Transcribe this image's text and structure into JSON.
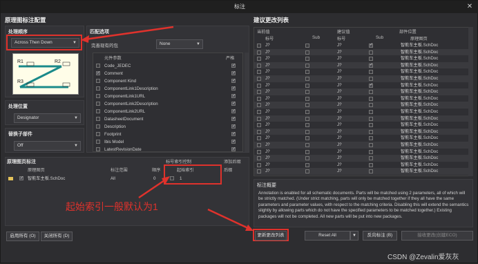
{
  "window": {
    "title": "标注",
    "close": "✕"
  },
  "left_title": "原理图标注配置",
  "order_panel": {
    "title": "处理顺序",
    "selected": "Across Then Down"
  },
  "location_panel": {
    "title": "处理位置",
    "selected": "Designator"
  },
  "replace_panel": {
    "title": "替换子部件",
    "selected": "Off"
  },
  "match_panel": {
    "title": "匹配选项",
    "pkg_label": "完善现有的包",
    "pkg_value": "None",
    "col_param": "元件参数",
    "col_strict": "严格",
    "params": [
      {
        "name": "Code_JEDEC",
        "checked": false,
        "strict": true
      },
      {
        "name": "Comment",
        "checked": true,
        "strict": true
      },
      {
        "name": "Component Kind",
        "checked": false,
        "strict": true
      },
      {
        "name": "ComponentLink1Description",
        "checked": false,
        "strict": true
      },
      {
        "name": "ComponentLink1URL",
        "checked": false,
        "strict": true
      },
      {
        "name": "ComponentLink2Description",
        "checked": false,
        "strict": true
      },
      {
        "name": "ComponentLink2URL",
        "checked": false,
        "strict": true
      },
      {
        "name": "DatasheetDocument",
        "checked": false,
        "strict": true
      },
      {
        "name": "Description",
        "checked": false,
        "strict": true
      },
      {
        "name": "Footprint",
        "checked": false,
        "strict": true
      },
      {
        "name": "Ibis Model",
        "checked": false,
        "strict": true
      },
      {
        "name": "LatestRevisionDate",
        "checked": false,
        "strict": true
      }
    ]
  },
  "sheet_panel": {
    "title": "原理图页标注",
    "col_sheet": "原理图页",
    "col_scope": "标注范围",
    "col_order": "顺序",
    "col_index_ctrl": "标号索引控制",
    "col_start_index": "起始索引",
    "col_suffix": "添加后缀",
    "col_suffix2": "后缀",
    "rows": [
      {
        "sheet": "智能车主板.SchDoc",
        "scope": "All",
        "order": "0",
        "index": "1"
      }
    ]
  },
  "annotation_text": "起始索引一般默认为1",
  "left_buttons": {
    "enable_all": "启用所有 (O)",
    "close_all": "关闭所有 (D)"
  },
  "right_title": "建议更改列表",
  "changes": {
    "col_current": "当前值",
    "col_proposed": "建议值",
    "col_location": "部件位置",
    "col_designator": "标号",
    "col_sub": "Sub",
    "col_designator2": "标号",
    "col_sub2": "Sub",
    "col_sheet": "原理图页",
    "rows": [
      {
        "cur": "J?",
        "pro": "J?",
        "sheet": "智能车主板.SchDoc",
        "c1": false,
        "c2": true
      },
      {
        "cur": "J?",
        "pro": "J?",
        "sheet": "智能车主板.SchDoc",
        "c1": false,
        "c2": false
      },
      {
        "cur": "J?",
        "pro": "J?",
        "sheet": "智能车主板.SchDoc",
        "c1": false,
        "c2": false
      },
      {
        "cur": "J?",
        "pro": "J?",
        "sheet": "智能车主板.SchDoc",
        "c1": false,
        "c2": true
      },
      {
        "cur": "J?",
        "pro": "J?",
        "sheet": "智能车主板.SchDoc",
        "c1": false,
        "c2": false
      },
      {
        "cur": "J?",
        "pro": "J?",
        "sheet": "智能车主板.SchDoc",
        "c1": false,
        "c2": false
      },
      {
        "cur": "J?",
        "pro": "J?",
        "sheet": "智能车主板.SchDoc",
        "c1": false,
        "c2": true
      },
      {
        "cur": "J?",
        "pro": "J?",
        "sheet": "智能车主板.SchDoc",
        "c1": false,
        "c2": false
      },
      {
        "cur": "J?",
        "pro": "J?",
        "sheet": "智能车主板.SchDoc",
        "c1": false,
        "c2": false
      },
      {
        "cur": "J?",
        "pro": "J?",
        "sheet": "智能车主板.SchDoc",
        "c1": false,
        "c2": false
      },
      {
        "cur": "J?",
        "pro": "J?",
        "sheet": "智能车主板.SchDoc",
        "c1": false,
        "c2": false
      },
      {
        "cur": "J?",
        "pro": "J?",
        "sheet": "智能车主板.SchDoc",
        "c1": false,
        "c2": false
      },
      {
        "cur": "J?",
        "pro": "J?",
        "sheet": "智能车主板.SchDoc",
        "c1": false,
        "c2": false
      },
      {
        "cur": "J?",
        "pro": "J?",
        "sheet": "智能车主板.SchDoc",
        "c1": false,
        "c2": false
      },
      {
        "cur": "J?",
        "pro": "J?",
        "sheet": "智能车主板.SchDoc",
        "c1": false,
        "c2": false
      },
      {
        "cur": "J?",
        "pro": "J?",
        "sheet": "智能车主板.SchDoc",
        "c1": false,
        "c2": false
      },
      {
        "cur": "J?",
        "pro": "J?",
        "sheet": "智能车主板.SchDoc",
        "c1": false,
        "c2": false
      },
      {
        "cur": "J?",
        "pro": "J?",
        "sheet": "智能车主板.SchDoc",
        "c1": false,
        "c2": false
      },
      {
        "cur": "J?",
        "pro": "J?",
        "sheet": "智能车主板.SchDoc",
        "c1": false,
        "c2": false
      },
      {
        "cur": "J?",
        "pro": "J?",
        "sheet": "智能车主板.SchDoc",
        "c1": false,
        "c2": false
      }
    ]
  },
  "summary": {
    "title": "标注概要",
    "text": "Annotation is enabled for all schematic documents. Parts will be matched using 2 parameters, all of which will be strictly matched. (Under strict matching, parts will only be matched together if they all have the same parameters and parameter values, with respect to the matching criteria. Disabling this will extend the semantics slightly by allowing parts which do not have the specified parameters to be matched together.) Existing packages will not be completed. All new parts will be put into new packages."
  },
  "right_buttons": {
    "update": "更新更改列表",
    "reset": "Reset All",
    "reverse": "反向标注 (B)",
    "accept": "接收更改(创建ECO)"
  },
  "watermark": "CSDN @Zevalin爱灰灰",
  "diagram_labels": {
    "r1": "R1",
    "r2": "R2",
    "r3": "R3"
  }
}
